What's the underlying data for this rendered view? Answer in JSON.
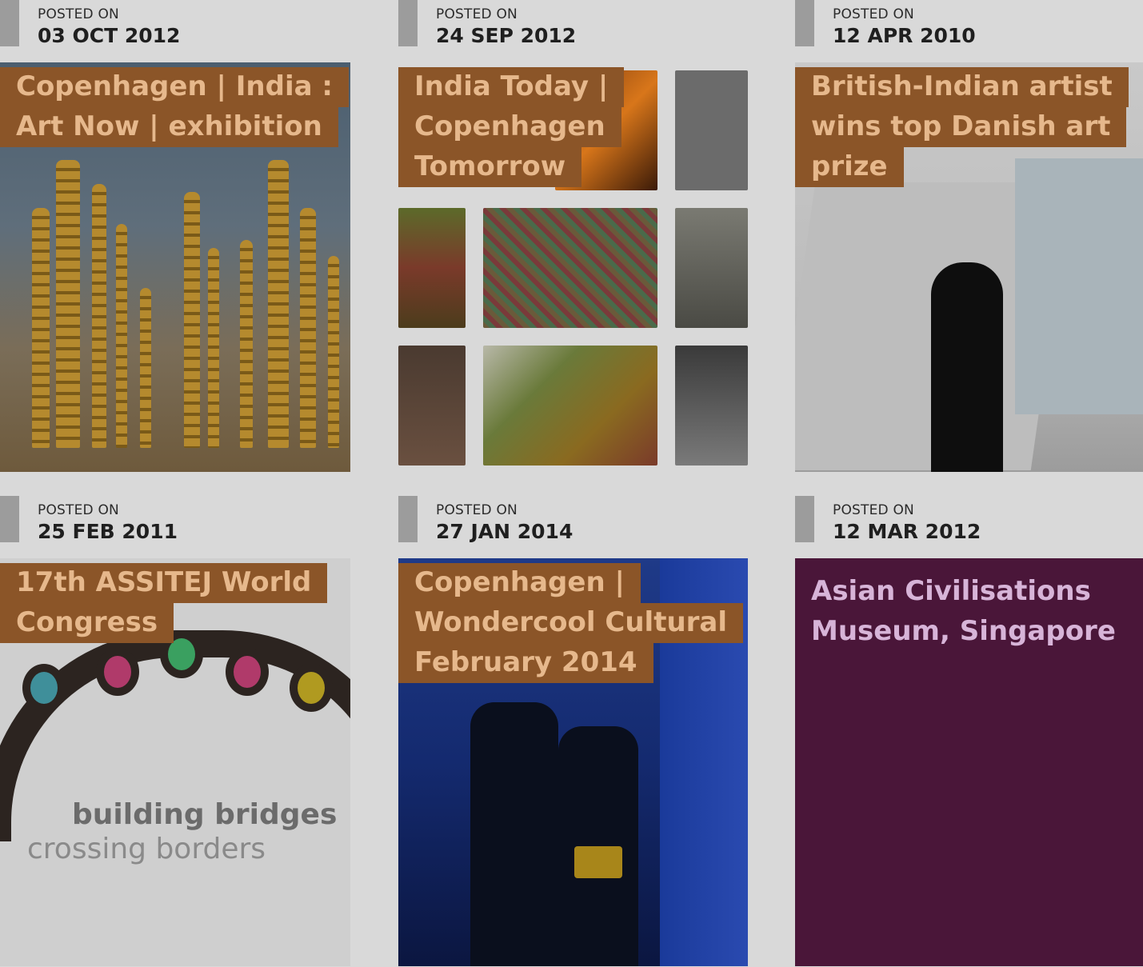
{
  "posts": [
    {
      "label": "POSTED ON",
      "date": "03 OCT 2012",
      "title_lines": [
        "Copenhagen | India :",
        "Art Now | exhibition"
      ],
      "image": "golden-spires-installation"
    },
    {
      "label": "POSTED ON",
      "date": "24 SEP 2012",
      "title_lines": [
        "India Today |",
        "Copenhagen",
        "Tomorrow"
      ],
      "image": "photo-collage"
    },
    {
      "label": "POSTED ON",
      "date": "12 APR 2010",
      "title_lines": [
        "British-Indian artist",
        "wins top Danish art",
        "prize"
      ],
      "image": "artist-portrait"
    },
    {
      "label": "POSTED ON",
      "date": "25 FEB 2011",
      "title_lines": [
        "17th ASSITEJ World",
        "Congress"
      ],
      "image": "assitej-logo",
      "logo_text": [
        "building bridges",
        "crossing borders"
      ]
    },
    {
      "label": "POSTED ON",
      "date": "27 JAN 2014",
      "title_lines": [
        "Copenhagen |",
        "Wondercool Cultural",
        "February 2014"
      ],
      "image": "blue-stairway-silhouettes"
    },
    {
      "label": "POSTED ON",
      "date": "12 MAR 2012",
      "title_lines": [
        "Asian Civilisations",
        "Museum, Singapore"
      ],
      "image": "none"
    }
  ],
  "colors": {
    "title_bg": "#8b5528",
    "title_text": "#e6b88c",
    "purple_card": "#4a1639",
    "meta_bar": "#9c9c9c"
  }
}
